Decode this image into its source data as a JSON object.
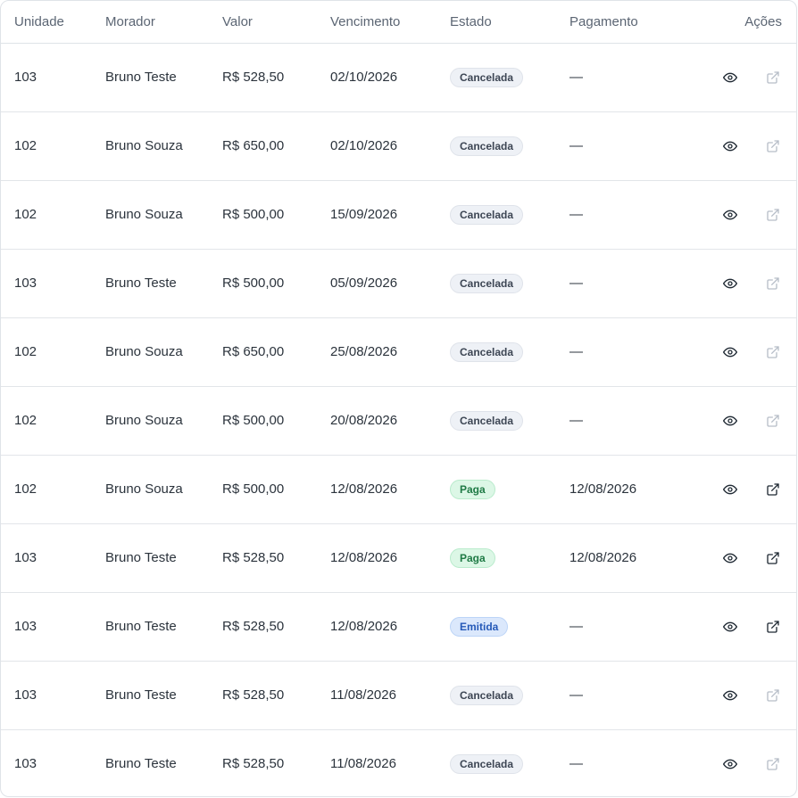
{
  "headers": {
    "unidade": "Unidade",
    "morador": "Morador",
    "valor": "Valor",
    "vencimento": "Vencimento",
    "estado": "Estado",
    "pagamento": "Pagamento",
    "acoes": "Ações"
  },
  "rows": [
    {
      "unidade": "103",
      "morador": "Bruno Teste",
      "valor": "R$ 528,50",
      "vencimento": "02/10/2026",
      "estado": "Cancelada",
      "pagamento": "—",
      "link_enabled": false
    },
    {
      "unidade": "102",
      "morador": "Bruno Souza",
      "valor": "R$ 650,00",
      "vencimento": "02/10/2026",
      "estado": "Cancelada",
      "pagamento": "—",
      "link_enabled": false
    },
    {
      "unidade": "102",
      "morador": "Bruno Souza",
      "valor": "R$ 500,00",
      "vencimento": "15/09/2026",
      "estado": "Cancelada",
      "pagamento": "—",
      "link_enabled": false
    },
    {
      "unidade": "103",
      "morador": "Bruno Teste",
      "valor": "R$ 500,00",
      "vencimento": "05/09/2026",
      "estado": "Cancelada",
      "pagamento": "—",
      "link_enabled": false
    },
    {
      "unidade": "102",
      "morador": "Bruno Souza",
      "valor": "R$ 650,00",
      "vencimento": "25/08/2026",
      "estado": "Cancelada",
      "pagamento": "—",
      "link_enabled": false
    },
    {
      "unidade": "102",
      "morador": "Bruno Souza",
      "valor": "R$ 500,00",
      "vencimento": "20/08/2026",
      "estado": "Cancelada",
      "pagamento": "—",
      "link_enabled": false
    },
    {
      "unidade": "102",
      "morador": "Bruno Souza",
      "valor": "R$ 500,00",
      "vencimento": "12/08/2026",
      "estado": "Paga",
      "pagamento": "12/08/2026",
      "link_enabled": true
    },
    {
      "unidade": "103",
      "morador": "Bruno Teste",
      "valor": "R$ 528,50",
      "vencimento": "12/08/2026",
      "estado": "Paga",
      "pagamento": "12/08/2026",
      "link_enabled": true
    },
    {
      "unidade": "103",
      "morador": "Bruno Teste",
      "valor": "R$ 528,50",
      "vencimento": "12/08/2026",
      "estado": "Emitida",
      "pagamento": "—",
      "link_enabled": true
    },
    {
      "unidade": "103",
      "morador": "Bruno Teste",
      "valor": "R$ 528,50",
      "vencimento": "11/08/2026",
      "estado": "Cancelada",
      "pagamento": "—",
      "link_enabled": false
    },
    {
      "unidade": "103",
      "morador": "Bruno Teste",
      "valor": "R$ 528,50",
      "vencimento": "11/08/2026",
      "estado": "Cancelada",
      "pagamento": "—",
      "link_enabled": false
    }
  ],
  "icons": {
    "view": "eye-icon",
    "open": "external-link-icon"
  },
  "colors": {
    "cancelada_bg": "#eef1f6",
    "paga_bg": "#dcf7e6",
    "emitida_bg": "#dbe8fc",
    "border": "#dfe3e8"
  }
}
